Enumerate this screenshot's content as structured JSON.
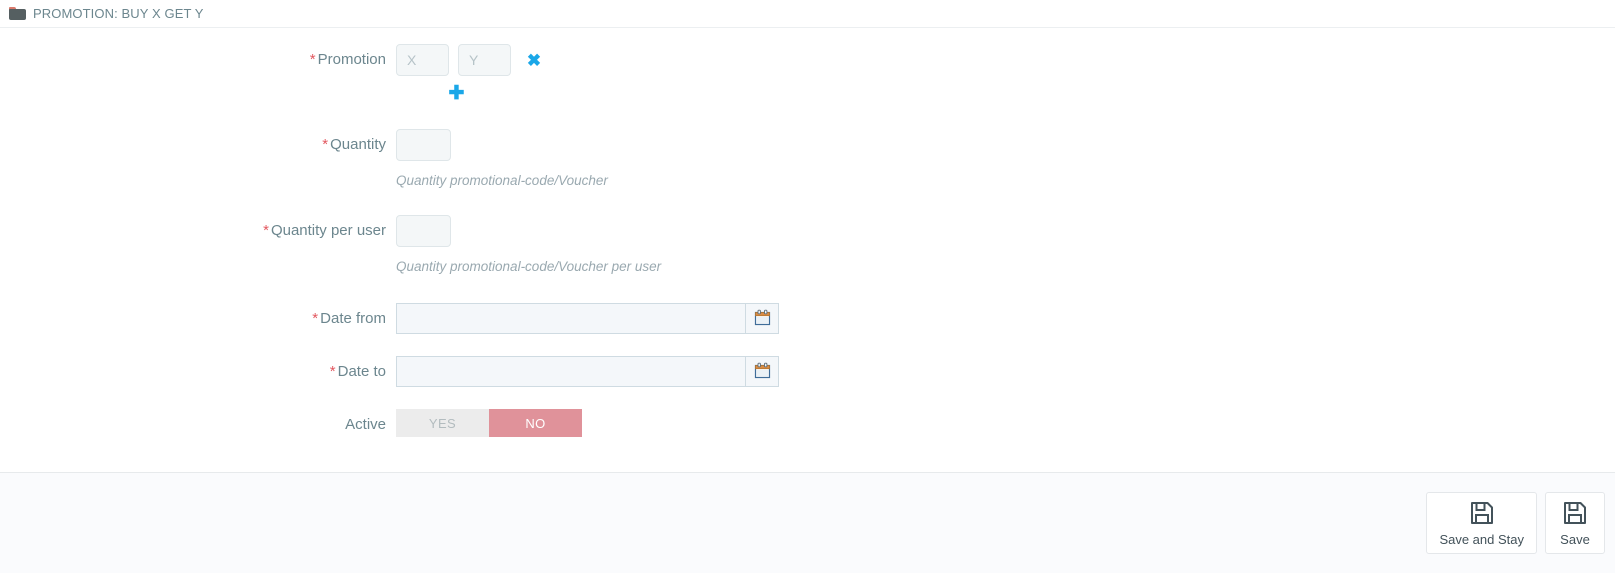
{
  "panel": {
    "icon": "folder-icon",
    "title": "PROMOTION: BUY X GET Y"
  },
  "form": {
    "promotion": {
      "label": "Promotion",
      "required_marker": "*",
      "x_placeholder": "X",
      "x_value": "",
      "y_placeholder": "Y",
      "y_value": "",
      "remove_icon": "✖",
      "add_icon": "✚"
    },
    "quantity": {
      "label": "Quantity",
      "required_marker": "*",
      "value": "",
      "help": "Quantity promotional-code/Voucher"
    },
    "quantity_per_user": {
      "label": "Quantity per user",
      "required_marker": "*",
      "value": "",
      "help": "Quantity promotional-code/Voucher per user"
    },
    "date_from": {
      "label": "Date from",
      "required_marker": "*",
      "value": "",
      "placeholder": "",
      "calendar_icon": "calendar-icon"
    },
    "date_to": {
      "label": "Date to",
      "required_marker": "*",
      "value": "",
      "placeholder": "",
      "calendar_icon": "calendar-icon"
    },
    "active": {
      "label": "Active",
      "yes_label": "YES",
      "no_label": "NO",
      "selected": "NO"
    }
  },
  "footer": {
    "save_and_stay_label": "Save and Stay",
    "save_label": "Save",
    "save_icon": "floppy-disk-icon"
  },
  "colors": {
    "accent_blue": "#1aa7e8",
    "required_red": "#e2575f",
    "switch_on_red": "#e0929a",
    "text": "#6c868e",
    "input_bg": "#f4f7f8",
    "input_border": "#dfe6e9",
    "footer_bg": "#fafbfd"
  }
}
